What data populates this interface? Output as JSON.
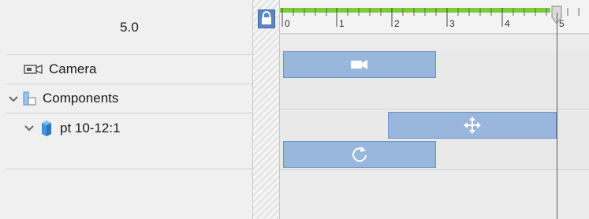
{
  "current_time": "5.0",
  "tracks": [
    {
      "label": "Camera",
      "icon": "camera-icon"
    },
    {
      "label": "Components",
      "icon": "components-icon"
    },
    {
      "label": "pt 10-12:1",
      "icon": "object-cube-icon"
    }
  ],
  "ruler": {
    "ticks": [
      "0",
      "1",
      "2",
      "3",
      "4",
      "5"
    ]
  },
  "colors": {
    "accent_green": "#7ccc36",
    "block_fill": "#99b6dc",
    "block_border": "#6f93c4"
  },
  "clip_icons": [
    "video-camera-icon",
    "move-arrows-icon",
    "rotate-icon"
  ]
}
